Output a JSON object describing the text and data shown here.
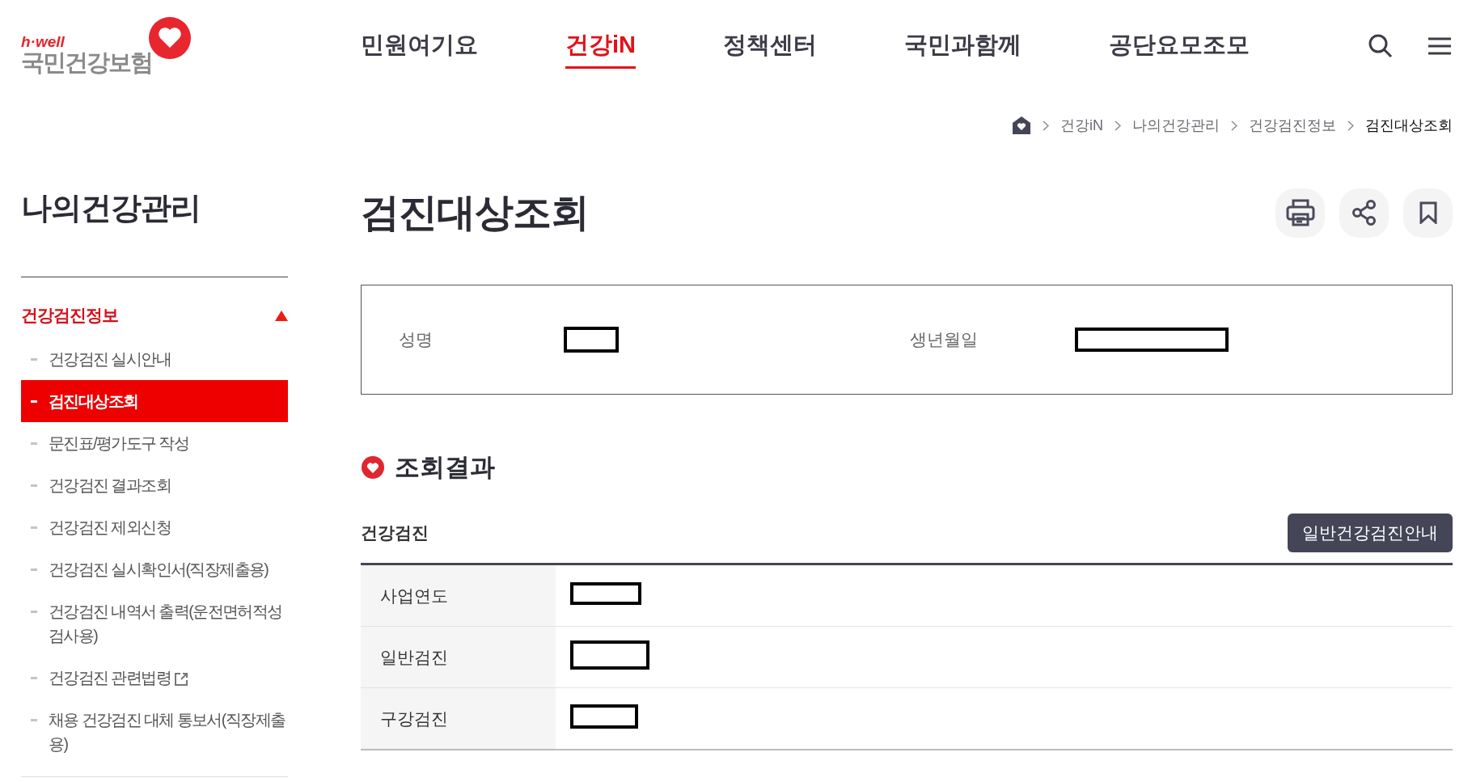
{
  "header": {
    "logo": {
      "tagline": "h·well",
      "name": "국민건강보험"
    },
    "nav": [
      {
        "label": "민원여기요",
        "selected": false
      },
      {
        "label": "건강iN",
        "selected": true
      },
      {
        "label": "정책센터",
        "selected": false
      },
      {
        "label": "국민과함께",
        "selected": false
      },
      {
        "label": "공단요모조모",
        "selected": false
      }
    ]
  },
  "breadcrumb": [
    "건강iN",
    "나의건강관리",
    "건강검진정보",
    "검진대상조회"
  ],
  "sidebar": {
    "title": "나의건강관리",
    "section": {
      "label": "건강검진정보",
      "expanded": true,
      "children": [
        {
          "label": "건강검진 실시안내",
          "selected": false,
          "external": false
        },
        {
          "label": "검진대상조회",
          "selected": true,
          "external": false
        },
        {
          "label": "문진표/평가도구 작성",
          "selected": false,
          "external": false
        },
        {
          "label": "건강검진 결과조회",
          "selected": false,
          "external": false
        },
        {
          "label": "건강검진 제외신청",
          "selected": false,
          "external": false
        },
        {
          "label": "건강검진 실시확인서(직장제출용)",
          "selected": false,
          "external": false
        },
        {
          "label": "건강검진 내역서 출력(운전면허적성검사용)",
          "selected": false,
          "external": false
        },
        {
          "label": "건강검진 관련법령",
          "selected": false,
          "external": true
        },
        {
          "label": "채용 건강검진 대체 통보서(직장제출용)",
          "selected": false,
          "external": false
        }
      ]
    }
  },
  "page_title": "검진대상조회",
  "person": [
    {
      "label": "성명",
      "value": {
        "kind": "redacted"
      }
    },
    {
      "label": "생년월일",
      "value": {
        "kind": "redacted"
      }
    }
  ],
  "results": {
    "heading": "조회결과",
    "subheading": "건강검진",
    "button": "일반건강검진안내",
    "rows": [
      {
        "label": "사업연도",
        "value": {
          "kind": "redacted"
        }
      },
      {
        "label": "일반검진",
        "value": {
          "kind": "redacted"
        }
      },
      {
        "label": "구강검진",
        "value": {
          "kind": "redacted"
        }
      }
    ]
  }
}
